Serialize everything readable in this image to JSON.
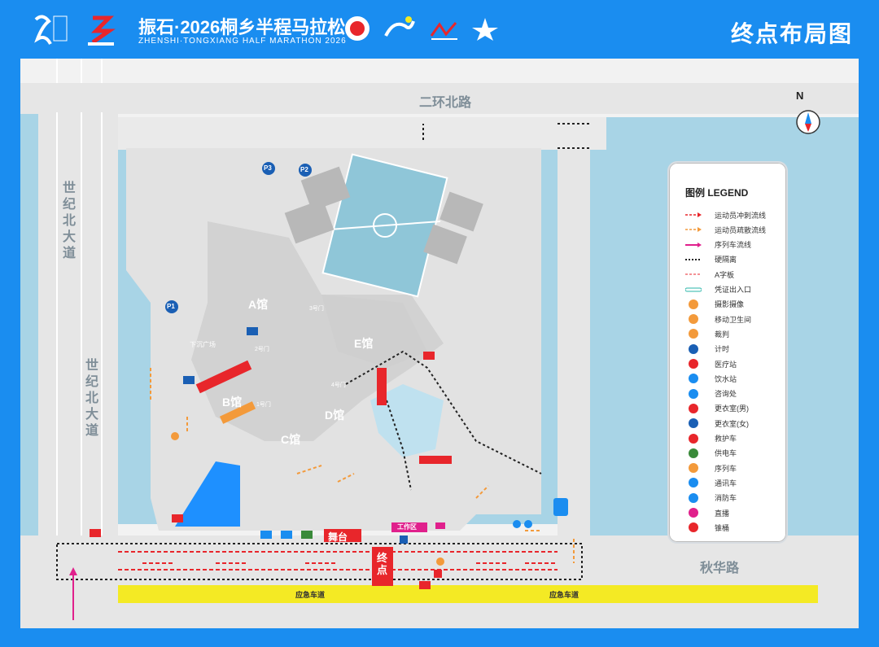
{
  "header": {
    "event_name": "振石·2026桐乡半程马拉松",
    "event_name_en": "ZHENSHI·TONGXIANG HALF MARATHON 2026",
    "page_title": "终点布局图"
  },
  "roads": {
    "north": "二环北路",
    "south": "秋华路",
    "west_1": "世纪北大道",
    "west_2": "世纪北大道",
    "emergency_lane": "应急车道"
  },
  "compass": {
    "label": "N"
  },
  "parking": [
    "P1",
    "P2",
    "P3"
  ],
  "halls": [
    "A馆",
    "B馆",
    "C馆",
    "D馆",
    "E馆"
  ],
  "gates": [
    "1号门",
    "2号门",
    "3号门",
    "4号门"
  ],
  "zones": {
    "stage": "舞台",
    "finish": "终点",
    "work_area": "工作区",
    "underground": "下沉广场"
  },
  "legend": {
    "title": "图例  LEGEND",
    "items": [
      {
        "label": "运动员冲刺流线",
        "icon": "red-dashed-arrow"
      },
      {
        "label": "运动员疏散流线",
        "icon": "orange-dashed-arrow"
      },
      {
        "label": "序列车流线",
        "icon": "magenta-arrow"
      },
      {
        "label": "硬隔离",
        "icon": "black-dotted-line"
      },
      {
        "label": "A字板",
        "icon": "red-dashed-line"
      },
      {
        "label": "凭证出入口",
        "icon": "teal-line"
      },
      {
        "label": "摄影摄像",
        "icon": "camera-icon"
      },
      {
        "label": "移动卫生间",
        "icon": "toilet-icon"
      },
      {
        "label": "裁判",
        "icon": "referee-icon"
      },
      {
        "label": "计时",
        "icon": "timer-icon"
      },
      {
        "label": "医疗站",
        "icon": "medical-icon"
      },
      {
        "label": "饮水站",
        "icon": "water-icon"
      },
      {
        "label": "咨询处",
        "icon": "info-icon"
      },
      {
        "label": "更衣室(男)",
        "icon": "male-changing-icon"
      },
      {
        "label": "更衣室(女)",
        "icon": "female-changing-icon"
      },
      {
        "label": "救护车",
        "icon": "ambulance-icon"
      },
      {
        "label": "供电车",
        "icon": "power-truck-icon"
      },
      {
        "label": "序列车",
        "icon": "sequence-car-icon"
      },
      {
        "label": "通讯车",
        "icon": "comm-truck-icon"
      },
      {
        "label": "消防车",
        "icon": "fire-truck-icon"
      },
      {
        "label": "直播",
        "icon": "live-broadcast-icon"
      },
      {
        "label": "锥桶",
        "icon": "cone-icon"
      }
    ]
  },
  "colors": {
    "frame": "#1a8df0",
    "water": "#a8d4e6",
    "road": "#e8e8e8",
    "building": "#dcdcdc",
    "finish_red": "#e8262b",
    "emergency_yellow": "#f4ea24",
    "parking_blue": "#1a5fb4"
  }
}
